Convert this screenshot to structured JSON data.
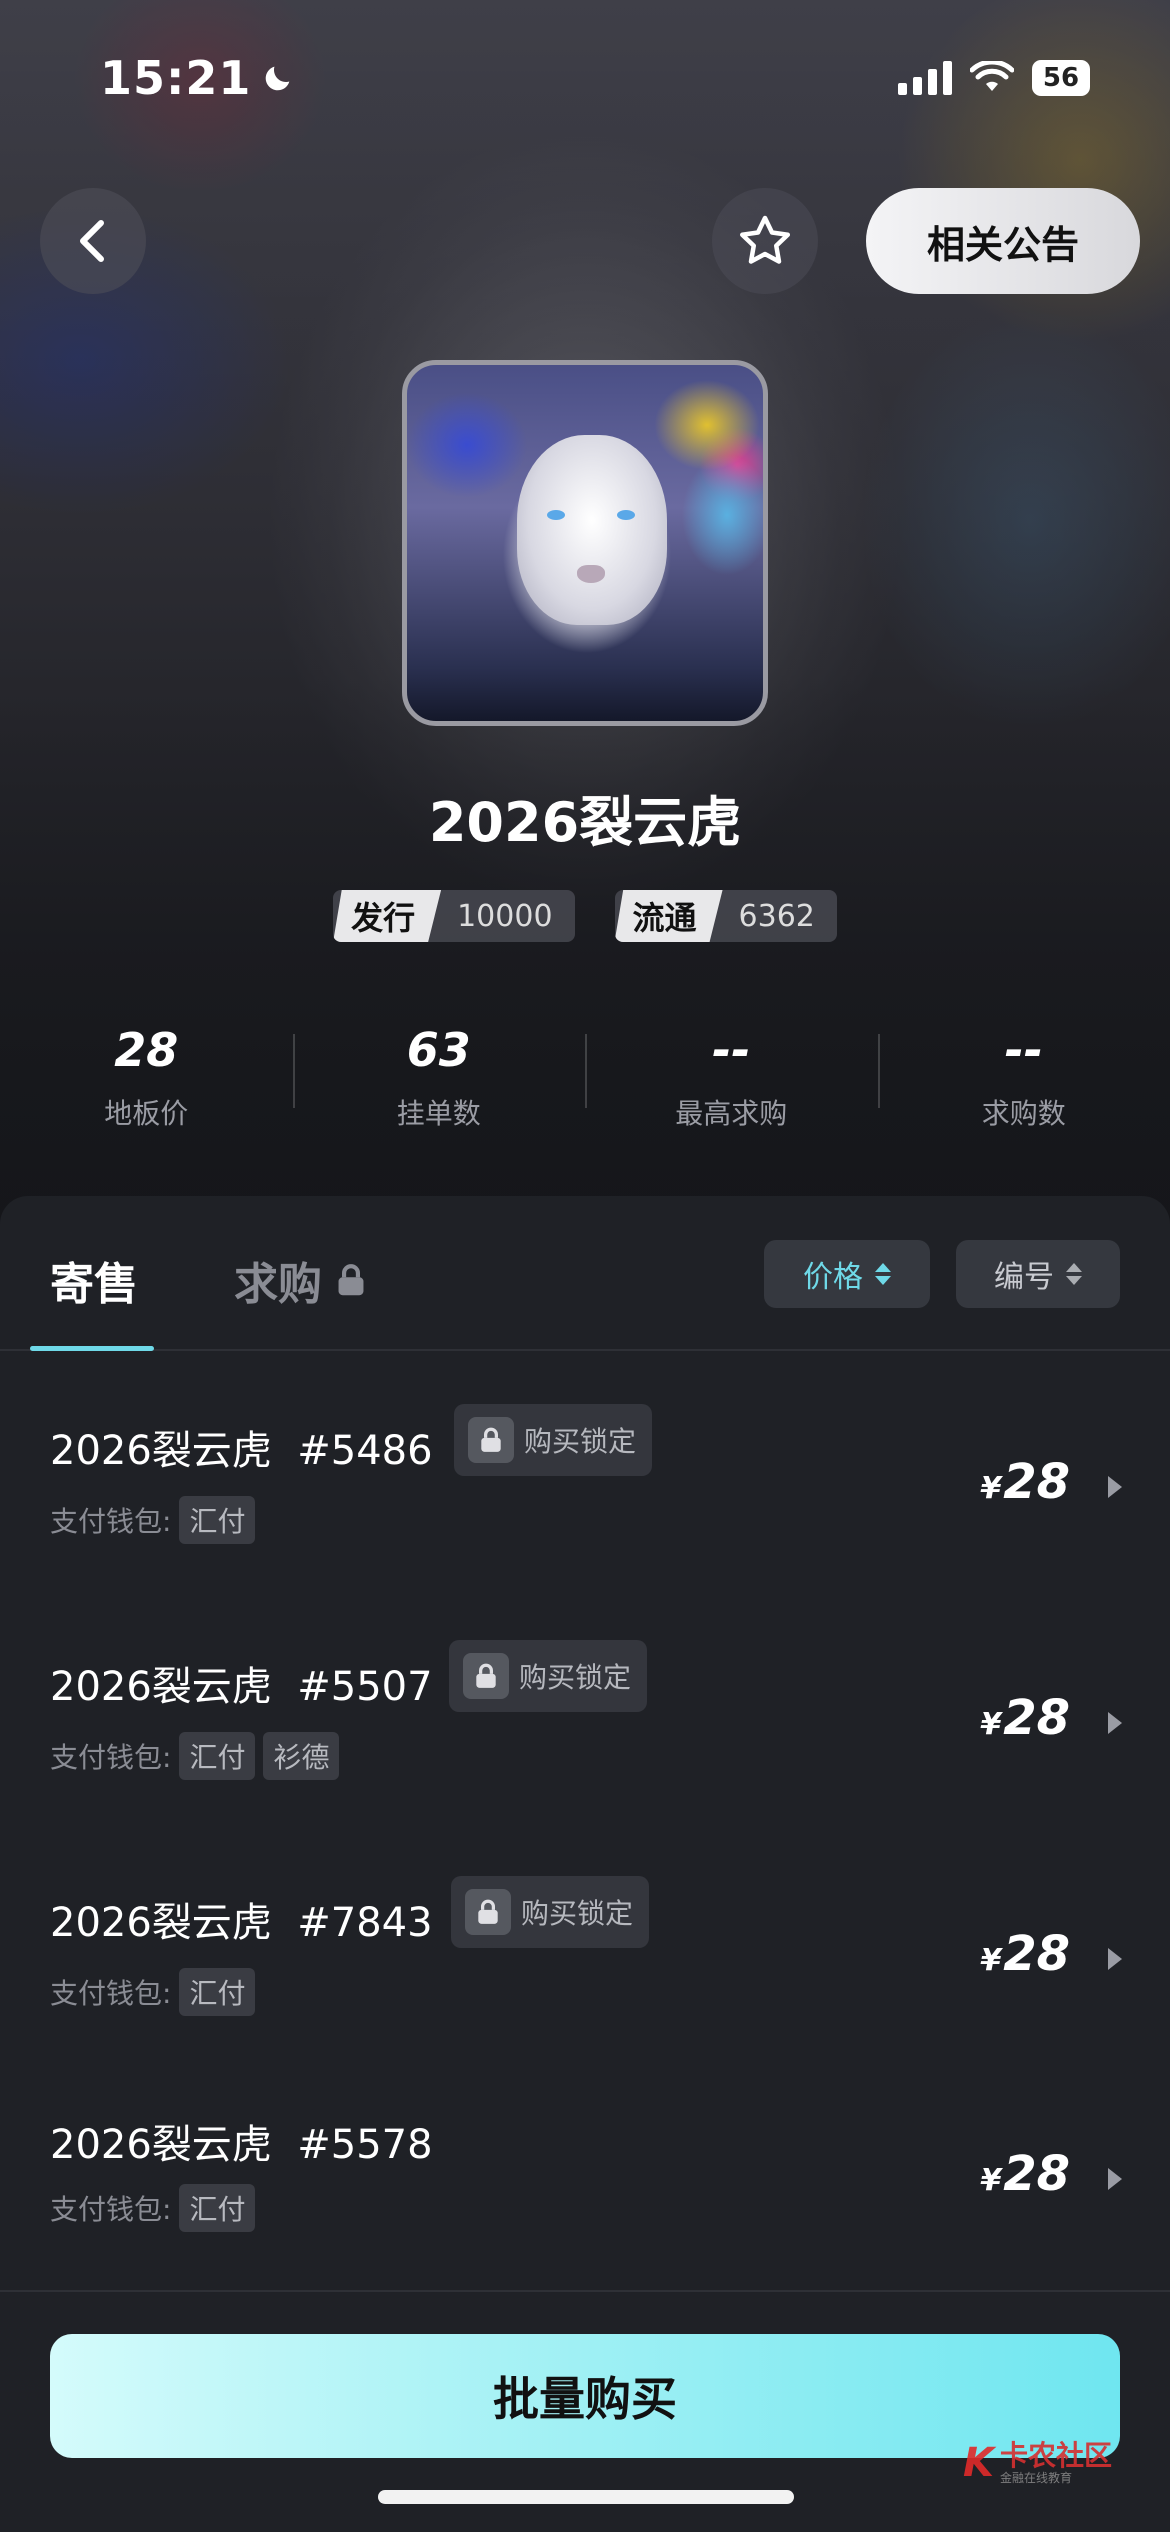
{
  "status_bar": {
    "time": "15:21",
    "battery": "56"
  },
  "header": {
    "notice_label": "相关公告"
  },
  "collection": {
    "title": "2026裂云虎",
    "badges": [
      {
        "key": "发行",
        "value": "10000"
      },
      {
        "key": "流通",
        "value": "6362"
      }
    ],
    "stats": [
      {
        "value": "28",
        "label": "地板价"
      },
      {
        "value": "63",
        "label": "挂单数"
      },
      {
        "value": "--",
        "label": "最高求购"
      },
      {
        "value": "--",
        "label": "求购数"
      }
    ]
  },
  "tabs": {
    "sell": "寄售",
    "buy": "求购"
  },
  "sort": {
    "price": "价格",
    "number": "编号"
  },
  "listings": [
    {
      "name": "2026裂云虎",
      "serial": "#5486",
      "locked": true,
      "lock_label": "购买锁定",
      "wallet_label": "支付钱包:",
      "wallets": [
        "汇付"
      ],
      "currency": "¥",
      "price": "28"
    },
    {
      "name": "2026裂云虎",
      "serial": "#5507",
      "locked": true,
      "lock_label": "购买锁定",
      "wallet_label": "支付钱包:",
      "wallets": [
        "汇付",
        "衫德"
      ],
      "currency": "¥",
      "price": "28"
    },
    {
      "name": "2026裂云虎",
      "serial": "#7843",
      "locked": true,
      "lock_label": "购买锁定",
      "wallet_label": "支付钱包:",
      "wallets": [
        "汇付"
      ],
      "currency": "¥",
      "price": "28"
    },
    {
      "name": "2026裂云虎",
      "serial": "#5578",
      "locked": false,
      "lock_label": "",
      "wallet_label": "支付钱包:",
      "wallets": [
        "汇付"
      ],
      "currency": "¥",
      "price": "28"
    }
  ],
  "bulk_buy_label": "批量购买",
  "watermark": {
    "line1": "卡农社区",
    "line2": "金融在线教育"
  },
  "colors": {
    "accent": "#6fd9e8",
    "panel_bg": "#1f2126"
  }
}
